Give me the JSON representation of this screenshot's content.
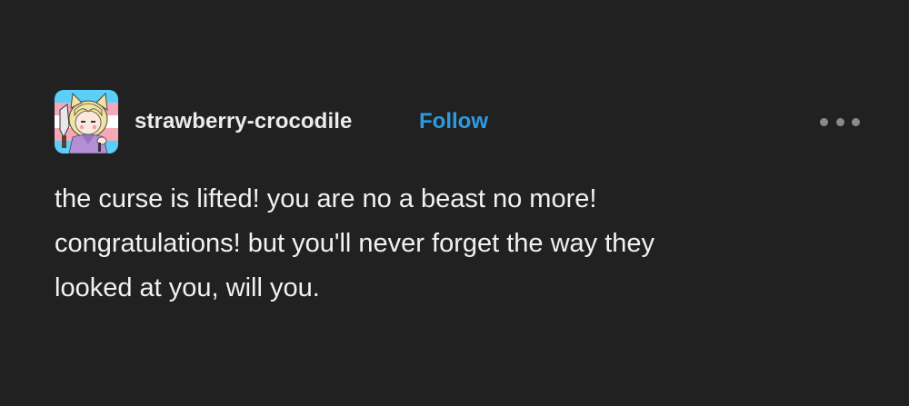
{
  "post": {
    "author": "strawberry-crocodile",
    "follow_label": "Follow",
    "more_icon": "more-horizontal-icon",
    "body_lines": [
      "the curse is lifted! you are no a beast no more!",
      "congratulations! but you'll never forget the way they",
      "looked at you, will you."
    ]
  },
  "colors": {
    "background": "#212121",
    "text": "#f2f2f2",
    "link": "#2c9ce0",
    "muted": "#8a8a8a"
  }
}
